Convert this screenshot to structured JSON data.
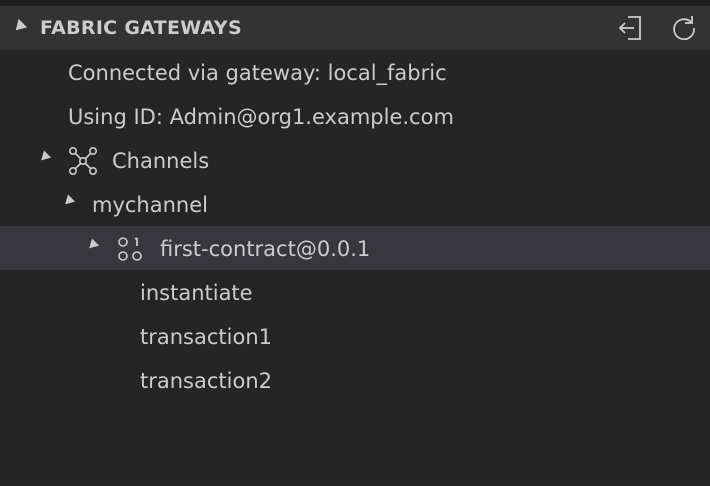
{
  "header": {
    "title": "FABRIC GATEWAYS",
    "actions": [
      {
        "name": "disconnect",
        "icon": "disconnect-icon"
      },
      {
        "name": "refresh",
        "icon": "refresh-icon"
      }
    ]
  },
  "tree": {
    "connected_via": "Connected via gateway: local_fabric",
    "using_id": "Using ID: Admin@org1.example.com",
    "channels_label": "Channels",
    "channel": {
      "label": "mychannel",
      "contract": {
        "label": "first-contract@0.0.1",
        "transactions": [
          "instantiate",
          "transaction1",
          "transaction2"
        ]
      }
    }
  },
  "colors": {
    "background": "#252526",
    "header_background": "#333333",
    "selected_row": "#37373d",
    "text": "#cccccc"
  }
}
